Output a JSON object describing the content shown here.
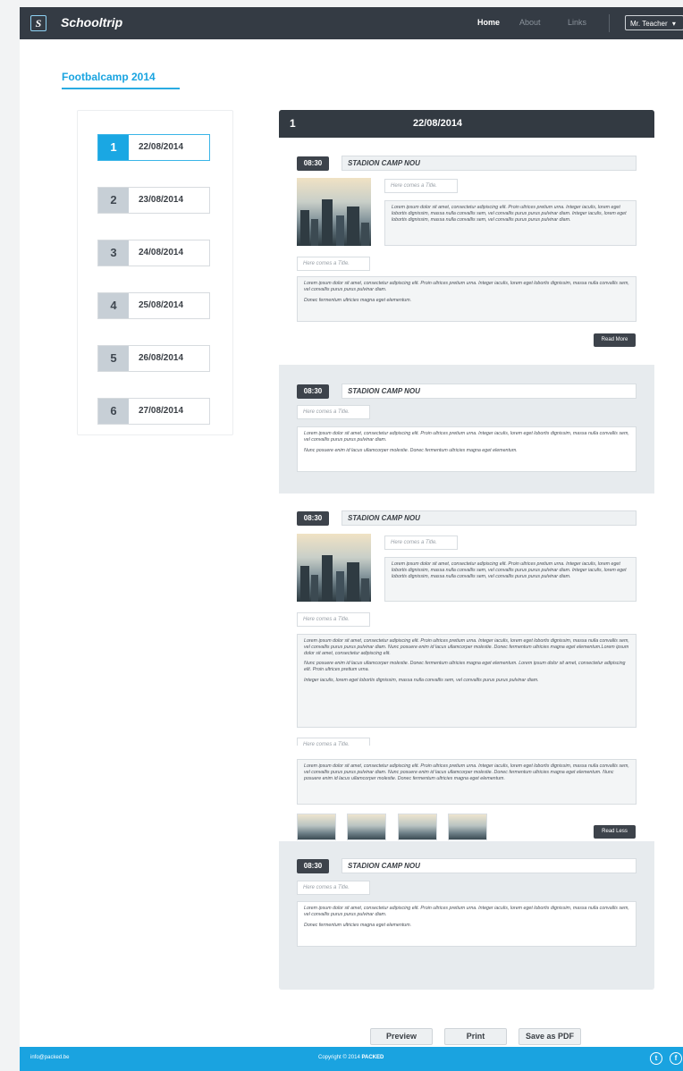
{
  "header": {
    "logo_letter": "S",
    "brand": "Schooltrip",
    "nav": [
      "Home",
      "About",
      "Links"
    ],
    "user": "Mr. Teacher",
    "user_caret": "▾"
  },
  "page_title": "Footbalcamp 2014",
  "days": [
    {
      "num": "1",
      "date": "22/08/2014"
    },
    {
      "num": "2",
      "date": "23/08/2014"
    },
    {
      "num": "3",
      "date": "24/08/2014"
    },
    {
      "num": "4",
      "date": "25/08/2014"
    },
    {
      "num": "5",
      "date": "26/08/2014"
    },
    {
      "num": "6",
      "date": "27/08/2014"
    }
  ],
  "selected_day": {
    "num": "1",
    "date": "22/08/2014"
  },
  "events": [
    {
      "time": "08:30",
      "location": "STADION CAMP NOU",
      "photo_title_placeholder": "Here comes a Title.",
      "photo_text": "Lorem ipsum dolor sit amet, consectetur adipiscing elit. Proin ultrices pretium urna. Integer iaculis, lorem eget lobortis dignissim, massa nulla convallis sem, vel convallis purus purus pulvinar diam. Integer iaculis, lorem eget lobortis dignissim, massa nulla convallis sem, vel convallis purus purus pulvinar diam.",
      "title_placeholder": "Here comes a Title.",
      "body": [
        "Lorem ipsum dolor sit amet, consectetur adipiscing elit. Proin ultrices pretium urna. Integer iaculis, lorem eget lobortis dignissim, massa nulla convallis sem, vel convallis purus purus pulvinar diam.",
        "Donec fermentum ultricies magna eget elementum."
      ],
      "button": "Read More"
    },
    {
      "time": "08:30",
      "location": "STADION CAMP NOU",
      "title_placeholder": "Here comes a Title.",
      "body": [
        "Lorem ipsum dolor sit amet, consectetur adipiscing elit. Proin ultrices pretium urna. Integer iaculis, lorem eget lobortis dignissim, massa nulla convallis sem, vel convallis purus purus pulvinar diam.",
        "Nunc posuere enim id lacus ullamcorper molestie. Donec fermentum ultricies magna eget elementum."
      ]
    },
    {
      "time": "08:30",
      "location": "STADION CAMP NOU",
      "photo_title_placeholder": "Here comes a Title.",
      "photo_text": "Lorem ipsum dolor sit amet, consectetur adipiscing elit. Proin ultrices pretium urna. Integer iaculis, lorem eget lobortis dignissim, massa nulla convallis sem, vel convallis purus purus pulvinar diam. Integer iaculis, lorem eget lobortis dignissim, massa nulla convallis sem, vel convallis purus purus pulvinar diam.",
      "title_placeholder": "Here comes a Title.",
      "body": [
        "Lorem ipsum dolor sit amet, consectetur adipiscing elit. Proin ultrices pretium urna. Integer iaculis, lorem eget lobortis dignissim, massa nulla convallis sem, vel convallis purus purus pulvinar diam. Nunc posuere enim id lacus ullamcorper molestie. Donec fermentum ultricies magna eget elementum.Lorem ipsum dolor sit amet, consectetur adipiscing elit.",
        "Nunc posuere enim id lacus ullamcorper molestie. Donec fermentum ultricies magna eget elementum. Lorem ipsum dolor sit amet, consectetur adipiscing elit. Proin ultrices pretium urna.",
        "Integer iaculis, lorem eget lobortis dignissim, massa nulla convallis sem, vel convallis purus purus pulvinar diam."
      ],
      "title2_placeholder": "Here comes a Title.",
      "body2": [
        "Lorem ipsum dolor sit amet, consectetur adipiscing elit. Proin ultrices pretium urna. Integer iaculis, lorem eget lobortis dignissim, massa nulla convallis sem, vel convallis purus purus pulvinar diam. Nunc posuere enim id lacus ullamcorper molestie. Donec fermentum ultricies magna eget elementum. Nunc posuere enim id lacus ullamcorper molestie. Donec fermentum ultricies magna eget elementum."
      ],
      "button": "Read Less"
    },
    {
      "time": "08:30",
      "location": "STADION CAMP NOU",
      "title_placeholder": "Here comes a Title.",
      "body": [
        "Lorem ipsum dolor sit amet, consectetur adipiscing elit. Proin ultrices pretium urna. Integer iaculis, lorem eget lobortis dignissim, massa nulla convallis sem, vel convallis purus purus pulvinar diam.",
        "Donec fermentum ultricies magna eget elementum."
      ]
    }
  ],
  "actions": [
    "Preview",
    "Print",
    "Save as PDF"
  ],
  "footer": {
    "email": "info@packed.be",
    "copyright": "Copyright © 2014",
    "company": "PACKED"
  },
  "social_icons": [
    "twitter-icon",
    "facebook-icon"
  ],
  "colors": {
    "accent": "#1aa3e0",
    "dark": "#343b44",
    "panel": "#e7ebee"
  }
}
